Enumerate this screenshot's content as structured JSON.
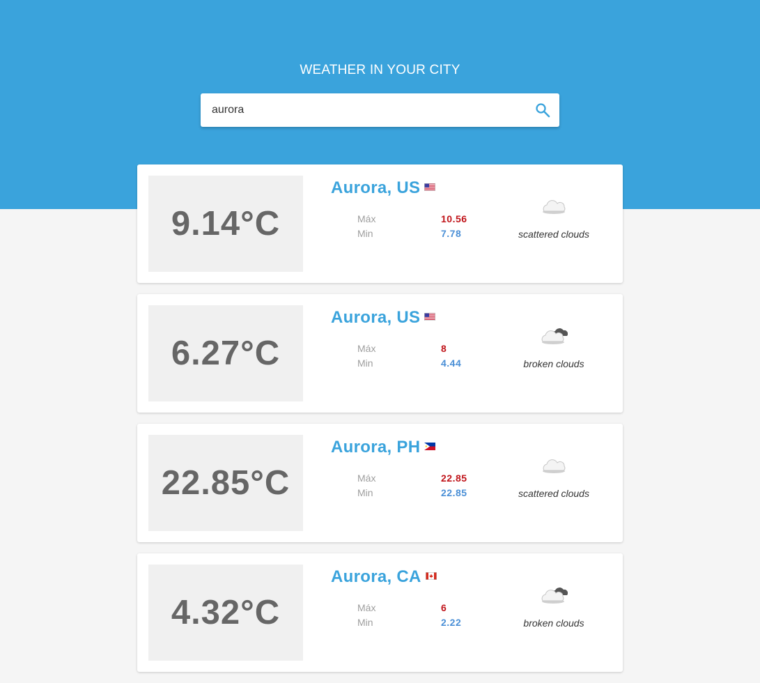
{
  "header": {
    "title": "WEATHER IN YOUR CITY"
  },
  "search": {
    "value": "aurora",
    "icon": "search-icon"
  },
  "results": [
    {
      "temp": "9.14°C",
      "city": "Aurora, US",
      "country": "US",
      "max_label": "Máx",
      "max": "10.56",
      "min_label": "Min",
      "min": "7.78",
      "description": "scattered clouds",
      "icon": "scattered-clouds-icon"
    },
    {
      "temp": "6.27°C",
      "city": "Aurora, US",
      "country": "US",
      "max_label": "Máx",
      "max": "8",
      "min_label": "Min",
      "min": "4.44",
      "description": "broken clouds",
      "icon": "broken-clouds-icon"
    },
    {
      "temp": "22.85°C",
      "city": "Aurora, PH",
      "country": "PH",
      "max_label": "Máx",
      "max": "22.85",
      "min_label": "Min",
      "min": "22.85",
      "description": "scattered clouds",
      "icon": "scattered-clouds-icon"
    },
    {
      "temp": "4.32°C",
      "city": "Aurora, CA",
      "country": "CA",
      "max_label": "Máx",
      "max": "6",
      "min_label": "Min",
      "min": "2.22",
      "description": "broken clouds",
      "icon": "broken-clouds-icon"
    }
  ],
  "colors": {
    "primary": "#3aa3dc",
    "max": "#c0141a",
    "min": "#4a8fd6",
    "background": "#f5f5f5"
  }
}
